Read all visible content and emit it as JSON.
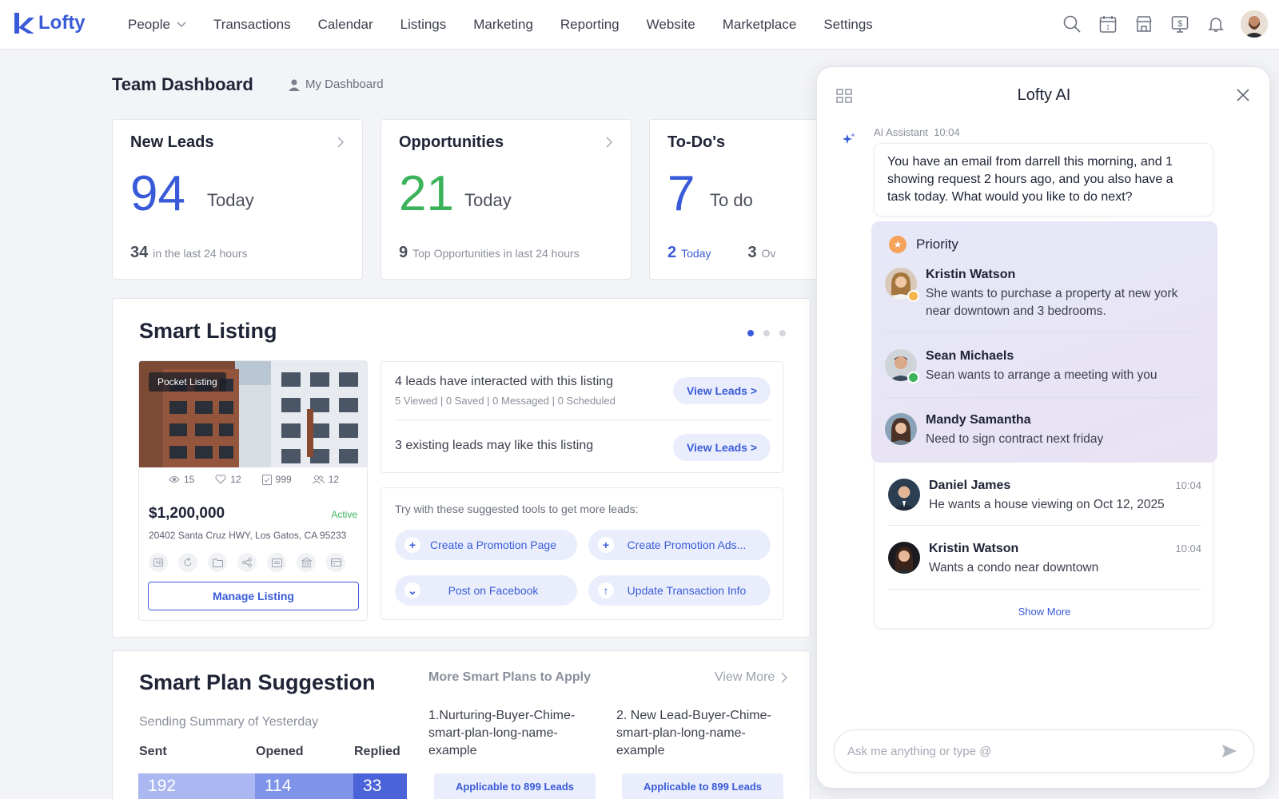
{
  "app": {
    "logo_text": "Lofty"
  },
  "nav": {
    "items": [
      "People",
      "Transactions",
      "Calendar",
      "Listings",
      "Marketing",
      "Reporting",
      "Website",
      "Marketplace",
      "Settings"
    ],
    "right_icons": [
      "search-icon",
      "calendar-icon",
      "store-icon",
      "dollar-icon",
      "bell-icon"
    ],
    "calendar_day": "1"
  },
  "header": {
    "title": "Team Dashboard",
    "my_dashboard": "My Dashboard"
  },
  "stats": [
    {
      "title": "New Leads",
      "value": "94",
      "value_label": "Today",
      "foot_num": "34",
      "foot_text": "in the last 24 hours",
      "color": "#3a5bd9"
    },
    {
      "title": "Opportunities",
      "value": "21",
      "value_label": "Today",
      "foot_num": "9",
      "foot_text": "Top Opportunities in last 24 hours",
      "color": "#3bb35a"
    },
    {
      "title": "To-Do's",
      "value": "7",
      "value_label": "To do",
      "foot_num": "2",
      "foot_text": "Today",
      "foot_num2": "3",
      "foot_text2": "Ov",
      "color": "#3a5bd9"
    }
  ],
  "smart_listing": {
    "title": "Smart Listing",
    "pager_active": 1,
    "pager_count": 3,
    "listing": {
      "tag": "Pocket Listing",
      "views": "15",
      "likes": "12",
      "saves": "999",
      "leads": "12",
      "price": "$1,200,000",
      "status": "Active",
      "address": "20402 Santa Cruz HWY, Los Gatos, CA 95233",
      "manage_label": "Manage Listing"
    },
    "leads_box": {
      "row1_title": "4 leads have interacted with this listing",
      "row1_sub": "5 Viewed | 0 Saved | 0 Messaged | 0 Scheduled",
      "row1_button": "View Leads >",
      "row2_title": "3 existing leads may like this listing",
      "row2_button": "View Leads >"
    },
    "tools": {
      "intro": "Try with these suggested tools to get more leads:",
      "items": [
        {
          "label": "Create a Promotion Page",
          "icon": "+"
        },
        {
          "label": "Create Promotion Ads...",
          "icon": "+"
        },
        {
          "label": "Post on Facebook",
          "icon": "⌄"
        },
        {
          "label": "Update Transaction Info",
          "icon": "↑"
        }
      ]
    }
  },
  "smart_plan": {
    "title": "Smart Plan Suggestion",
    "summary_label": "Sending Summary of Yesterday",
    "col_sent": "Sent",
    "col_opened": "Opened",
    "col_replied": "Replied",
    "sent": "192",
    "opened": "114",
    "replied": "33",
    "more_title": "More Smart Plans to Apply",
    "view_more": "View More",
    "plans": [
      {
        "name": "1.Nurturing-Buyer-Chime-smart-plan-long-name-example",
        "button": "Applicable to 899 Leads"
      },
      {
        "name": "2. New Lead-Buyer-Chime-smart-plan-long-name-example",
        "button": "Applicable to 899 Leads"
      }
    ]
  },
  "ai": {
    "title": "Lofty AI",
    "sender": "AI Assistant",
    "time": "10:04",
    "message": "You have an email from darrell this morning, and 1 showing request 2 hours ago, and you also have a task today. What would you like to do next?",
    "priority_label": "Priority",
    "priority": [
      {
        "name": "Kristin Watson",
        "text": "She wants to purchase a property at new york near downtown and 3 bedrooms.",
        "badge_color": "#f5b54a"
      },
      {
        "name": "Sean Michaels",
        "text": "Sean wants to arrange a meeting with you",
        "badge_color": "#3bb35a"
      },
      {
        "name": "Mandy Samantha",
        "text": "Need to sign contract next friday"
      }
    ],
    "others": [
      {
        "name": "Daniel James",
        "text": "He wants a house viewing on Oct 12, 2025",
        "time": "10:04"
      },
      {
        "name": "Kristin Watson",
        "text": "Wants a condo near downtown",
        "time": "10:04"
      }
    ],
    "show_more": "Show More",
    "input_placeholder": "Ask me anything or type @"
  }
}
